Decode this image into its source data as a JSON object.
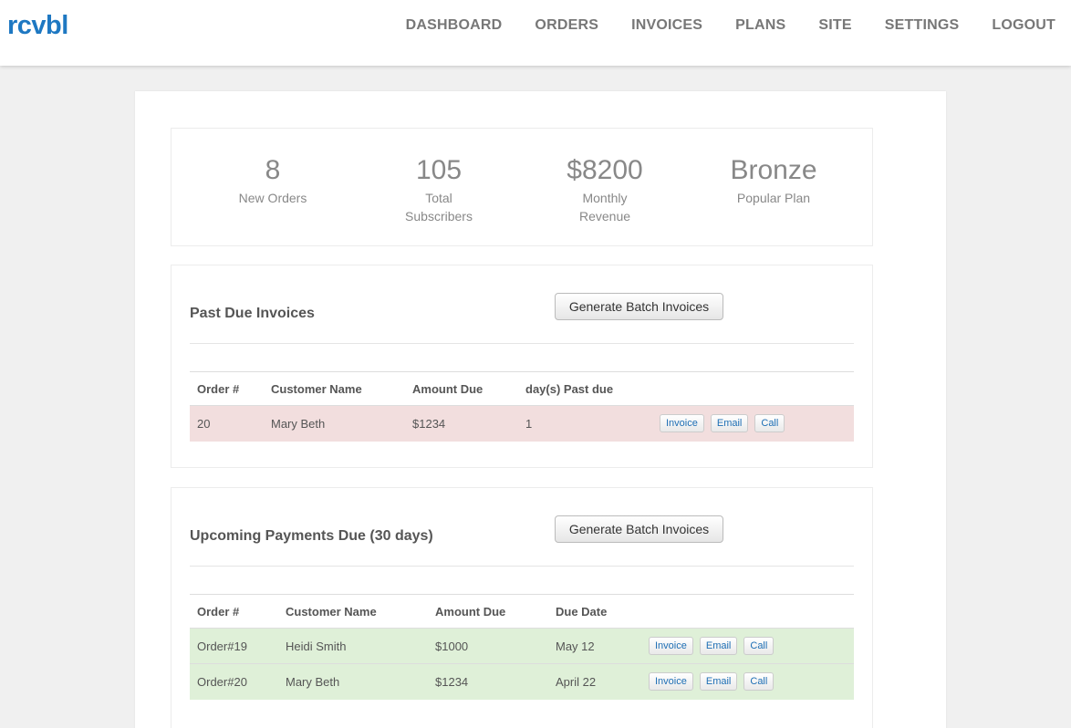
{
  "header": {
    "brand": "rcvbl",
    "nav": [
      "DASHBOARD",
      "ORDERS",
      "INVOICES",
      "PLANS",
      "SITE",
      "SETTINGS",
      "LOGOUT"
    ]
  },
  "stats": [
    {
      "value": "8",
      "label": "New Orders"
    },
    {
      "value": "105",
      "label": "Total Subscribers"
    },
    {
      "value": "$8200",
      "label": "Monthly Revenue"
    },
    {
      "value": "Bronze",
      "label": "Popular Plan"
    }
  ],
  "past_due": {
    "title": "Past Due Invoices",
    "batch_button": "Generate Batch Invoices",
    "columns": [
      "Order #",
      "Customer Name",
      "Amount Due",
      "day(s) Past due"
    ],
    "rows": [
      {
        "order": "20",
        "customer": "Mary Beth",
        "amount": "$1234",
        "days": "1"
      }
    ],
    "actions": {
      "invoice": "Invoice",
      "email": "Email",
      "call": "Call"
    }
  },
  "upcoming": {
    "title": "Upcoming Payments Due (30 days)",
    "batch_button": "Generate Batch Invoices",
    "columns": [
      "Order #",
      "Customer Name",
      "Amount Due",
      "Due Date"
    ],
    "rows": [
      {
        "order": "Order#19",
        "customer": "Heidi Smith",
        "amount": "$1000",
        "due": "May 12"
      },
      {
        "order": "Order#20",
        "customer": "Mary Beth",
        "amount": "$1234",
        "due": "April 22"
      }
    ],
    "actions": {
      "invoice": "Invoice",
      "email": "Email",
      "call": "Call"
    }
  },
  "colors": {
    "brand": "#1e78c2",
    "past_due_row": "#f2dede",
    "upcoming_row": "#dff0d8"
  }
}
